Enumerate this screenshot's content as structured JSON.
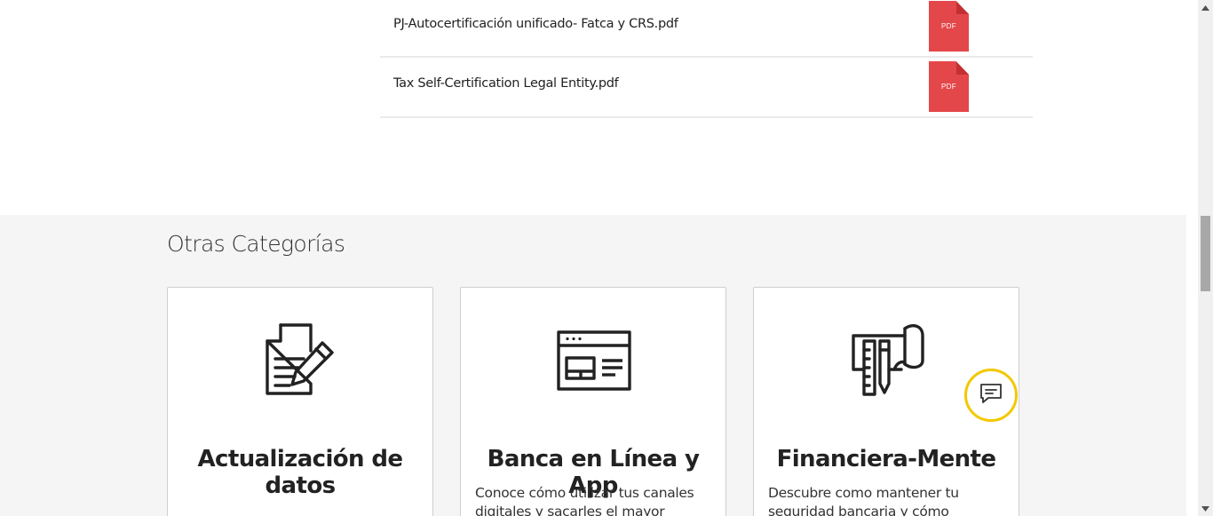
{
  "files": [
    {
      "name": "PJ-Autocertificación unificado- Fatca y CRS.pdf",
      "badge": "PDF"
    },
    {
      "name": "Tax Self-Certification Legal Entity.pdf",
      "badge": "PDF"
    }
  ],
  "categories": {
    "heading": "Otras Categorías",
    "cards": [
      {
        "title": "Actualización de datos",
        "description": "",
        "icon": "document-edit-icon"
      },
      {
        "title": "Banca en Línea y App",
        "description": "Conoce cómo utilizar tus canales digitales y sacarles el mayor provecho",
        "icon": "browser-window-icon"
      },
      {
        "title": "Financiera-Mente",
        "description": "Descubre como mantener tu seguridad bancaria y cómo manejar tu dinero",
        "icon": "ruler-pencil-blueprint-icon"
      }
    ]
  },
  "chat": {
    "icon": "chat-icon"
  },
  "colors": {
    "pdf": "#e4474a",
    "chat_ring": "#f3c800",
    "section_bg": "#f5f5f5"
  }
}
